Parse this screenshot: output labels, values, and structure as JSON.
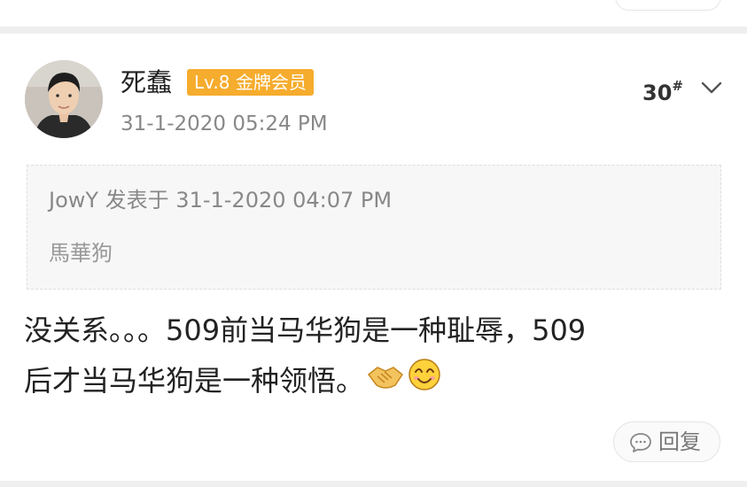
{
  "post": {
    "username": "死蠢",
    "badge": "Lv.8 金牌会员",
    "time": "31-1-2020 05:24 PM",
    "floor": "30",
    "floor_mark": "#",
    "quote": {
      "meta": "JowY 发表于 31-1-2020 04:07 PM",
      "text": "馬華狗"
    },
    "content_line1": "没关系。。。509前当马华狗是一种耻辱，509",
    "content_line2": "后才当马华狗是一种领悟。",
    "reply_label": "回复"
  },
  "colors": {
    "badge_bg": "#f6ac2d",
    "page_bg": "#efefef",
    "quote_bg": "#f7f7f7"
  },
  "icons": [
    "chevron-down-icon",
    "handshake-emoji",
    "smile-emoji",
    "comment-icon"
  ]
}
